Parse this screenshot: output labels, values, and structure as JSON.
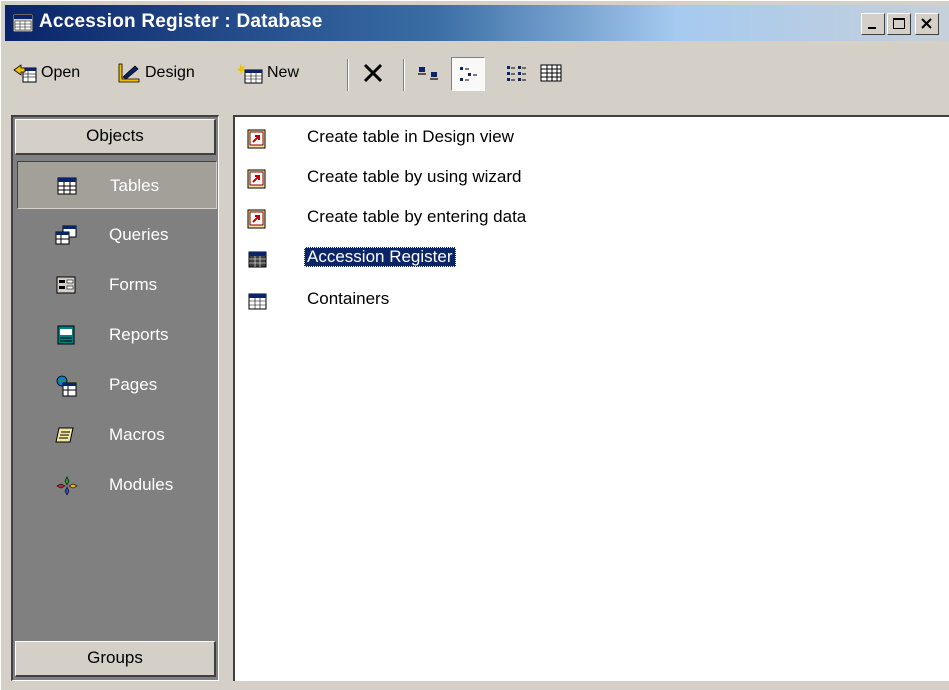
{
  "window": {
    "title": "Accession Register : Database",
    "caption_buttons": [
      "minimize",
      "maximize",
      "close"
    ]
  },
  "toolbar": {
    "open_label": "Open",
    "design_label": "Design",
    "new_label": "New",
    "delete_icon": "delete-x-icon",
    "view_buttons": [
      "large-icons",
      "small-icons",
      "list",
      "details"
    ],
    "active_view": "small-icons"
  },
  "objects_bar": {
    "header": "Objects",
    "items": [
      {
        "label": "Tables",
        "icon": "table-icon",
        "selected": true
      },
      {
        "label": "Queries",
        "icon": "query-icon",
        "selected": false
      },
      {
        "label": "Forms",
        "icon": "form-icon",
        "selected": false
      },
      {
        "label": "Reports",
        "icon": "report-icon",
        "selected": false
      },
      {
        "label": "Pages",
        "icon": "page-icon",
        "selected": false
      },
      {
        "label": "Macros",
        "icon": "macro-icon",
        "selected": false
      },
      {
        "label": "Modules",
        "icon": "module-icon",
        "selected": false
      }
    ],
    "groups_label": "Groups"
  },
  "list": {
    "items": [
      {
        "label": "Create table in Design view",
        "icon": "shortcut-icon",
        "selected": false
      },
      {
        "label": "Create table by using wizard",
        "icon": "shortcut-icon",
        "selected": false
      },
      {
        "label": "Create table by entering data",
        "icon": "shortcut-icon",
        "selected": false
      },
      {
        "label": "Accession Register",
        "icon": "table-icon",
        "selected": true
      },
      {
        "label": "Containers",
        "icon": "table-icon",
        "selected": false
      }
    ]
  },
  "colors": {
    "titlebar_start": "#0a246a",
    "selection": "#0a246a",
    "panel": "#d4d0c8",
    "objects_bar": "#808080"
  }
}
